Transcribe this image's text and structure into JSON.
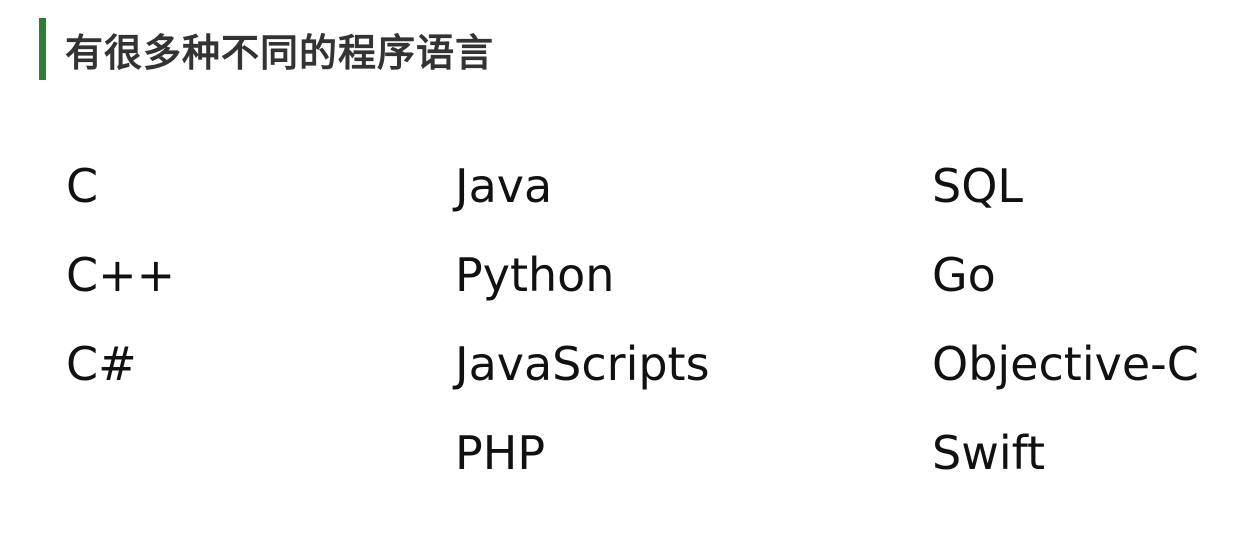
{
  "title": "有很多种不同的程序语言",
  "columns": [
    {
      "items": [
        "C",
        "C++",
        "C#"
      ]
    },
    {
      "items": [
        "Java",
        "Python",
        "JavaScripts",
        "PHP"
      ]
    },
    {
      "items": [
        "SQL",
        "Go",
        "Objective-C",
        "Swift"
      ]
    }
  ],
  "colors": {
    "accent": "#2e7d32",
    "title": "#333333",
    "text": "#111111"
  }
}
